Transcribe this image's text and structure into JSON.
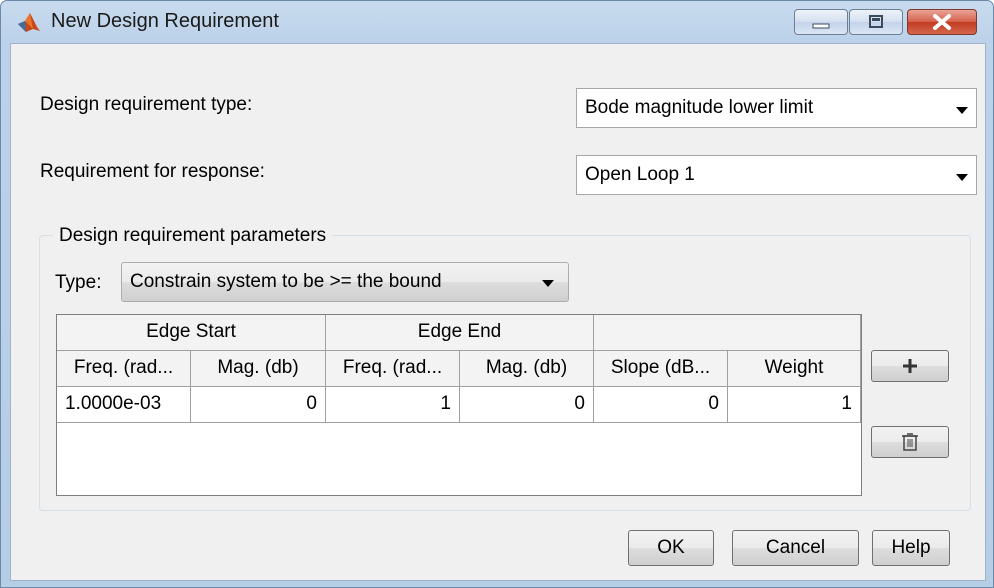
{
  "window": {
    "title": "New Design Requirement"
  },
  "form": {
    "design_type_label": "Design requirement type:",
    "design_type_value": "Bode magnitude lower limit",
    "response_label": "Requirement for response:",
    "response_value": "Open Loop 1"
  },
  "params": {
    "group_title": "Design requirement parameters",
    "type_label": "Type:",
    "type_value": "Constrain system to be >= the bound"
  },
  "table": {
    "group_headers": [
      "Edge Start",
      "Edge End",
      ""
    ],
    "columns": [
      "Freq. (rad...",
      "Mag. (db)",
      "Freq. (rad...",
      "Mag. (db)",
      "Slope (dB...",
      "Weight"
    ],
    "rows": [
      [
        "1.0000e-03",
        "0",
        "1",
        "0",
        "0",
        "1"
      ]
    ]
  },
  "side_buttons": {
    "add_icon": "plus-icon",
    "delete_icon": "trash-icon"
  },
  "buttons": {
    "ok": "OK",
    "cancel": "Cancel",
    "help": "Help"
  },
  "colors": {
    "title_gradient": "#bcd2ea",
    "close_button": "#c23b22",
    "client_bg": "#f0f0f0"
  }
}
